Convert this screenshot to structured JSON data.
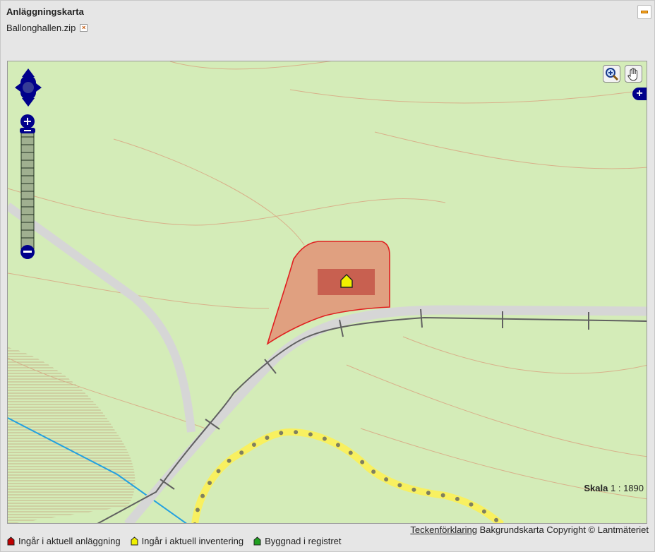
{
  "panel": {
    "title": "Anläggningskarta",
    "file_name": "Ballonghallen.zip",
    "remove_icon": "close-icon",
    "collapse_icon": "minimize-icon"
  },
  "map": {
    "scale_label": "Skala",
    "scale_value": "1 : 1890",
    "attribution_link": "Teckenförklaring",
    "attribution_text": "Bakgrundskarta Copyright © Lantmäteriet",
    "colors": {
      "land": "#d4ecb8",
      "road": "#d9d9d9",
      "facility_fill": "#e0a080",
      "facility_border": "#e02020",
      "water": "#22a0e0",
      "trail": "#f8f060"
    }
  },
  "legend": [
    {
      "label": "Ingår i aktuell anläggning",
      "color": "#c00000"
    },
    {
      "label": "Ingår i aktuell inventering",
      "color": "#f0f000"
    },
    {
      "label": "Byggnad i registret",
      "color": "#20a020"
    }
  ]
}
